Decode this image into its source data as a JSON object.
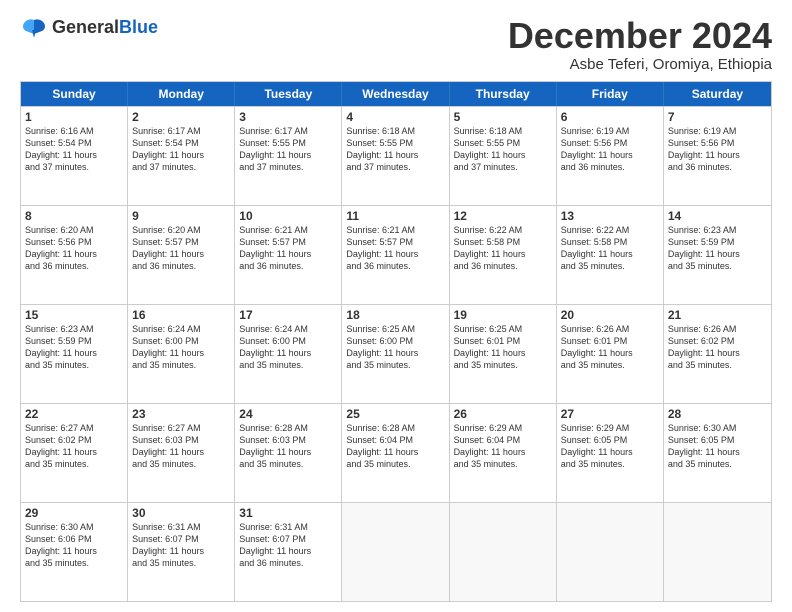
{
  "header": {
    "logo_general": "General",
    "logo_blue": "Blue",
    "month": "December 2024",
    "location": "Asbe Teferi, Oromiya, Ethiopia"
  },
  "days_of_week": [
    "Sunday",
    "Monday",
    "Tuesday",
    "Wednesday",
    "Thursday",
    "Friday",
    "Saturday"
  ],
  "weeks": [
    [
      {
        "day": "1",
        "lines": [
          "Sunrise: 6:16 AM",
          "Sunset: 5:54 PM",
          "Daylight: 11 hours",
          "and 37 minutes."
        ]
      },
      {
        "day": "2",
        "lines": [
          "Sunrise: 6:17 AM",
          "Sunset: 5:54 PM",
          "Daylight: 11 hours",
          "and 37 minutes."
        ]
      },
      {
        "day": "3",
        "lines": [
          "Sunrise: 6:17 AM",
          "Sunset: 5:55 PM",
          "Daylight: 11 hours",
          "and 37 minutes."
        ]
      },
      {
        "day": "4",
        "lines": [
          "Sunrise: 6:18 AM",
          "Sunset: 5:55 PM",
          "Daylight: 11 hours",
          "and 37 minutes."
        ]
      },
      {
        "day": "5",
        "lines": [
          "Sunrise: 6:18 AM",
          "Sunset: 5:55 PM",
          "Daylight: 11 hours",
          "and 37 minutes."
        ]
      },
      {
        "day": "6",
        "lines": [
          "Sunrise: 6:19 AM",
          "Sunset: 5:56 PM",
          "Daylight: 11 hours",
          "and 36 minutes."
        ]
      },
      {
        "day": "7",
        "lines": [
          "Sunrise: 6:19 AM",
          "Sunset: 5:56 PM",
          "Daylight: 11 hours",
          "and 36 minutes."
        ]
      }
    ],
    [
      {
        "day": "8",
        "lines": [
          "Sunrise: 6:20 AM",
          "Sunset: 5:56 PM",
          "Daylight: 11 hours",
          "and 36 minutes."
        ]
      },
      {
        "day": "9",
        "lines": [
          "Sunrise: 6:20 AM",
          "Sunset: 5:57 PM",
          "Daylight: 11 hours",
          "and 36 minutes."
        ]
      },
      {
        "day": "10",
        "lines": [
          "Sunrise: 6:21 AM",
          "Sunset: 5:57 PM",
          "Daylight: 11 hours",
          "and 36 minutes."
        ]
      },
      {
        "day": "11",
        "lines": [
          "Sunrise: 6:21 AM",
          "Sunset: 5:57 PM",
          "Daylight: 11 hours",
          "and 36 minutes."
        ]
      },
      {
        "day": "12",
        "lines": [
          "Sunrise: 6:22 AM",
          "Sunset: 5:58 PM",
          "Daylight: 11 hours",
          "and 36 minutes."
        ]
      },
      {
        "day": "13",
        "lines": [
          "Sunrise: 6:22 AM",
          "Sunset: 5:58 PM",
          "Daylight: 11 hours",
          "and 35 minutes."
        ]
      },
      {
        "day": "14",
        "lines": [
          "Sunrise: 6:23 AM",
          "Sunset: 5:59 PM",
          "Daylight: 11 hours",
          "and 35 minutes."
        ]
      }
    ],
    [
      {
        "day": "15",
        "lines": [
          "Sunrise: 6:23 AM",
          "Sunset: 5:59 PM",
          "Daylight: 11 hours",
          "and 35 minutes."
        ]
      },
      {
        "day": "16",
        "lines": [
          "Sunrise: 6:24 AM",
          "Sunset: 6:00 PM",
          "Daylight: 11 hours",
          "and 35 minutes."
        ]
      },
      {
        "day": "17",
        "lines": [
          "Sunrise: 6:24 AM",
          "Sunset: 6:00 PM",
          "Daylight: 11 hours",
          "and 35 minutes."
        ]
      },
      {
        "day": "18",
        "lines": [
          "Sunrise: 6:25 AM",
          "Sunset: 6:00 PM",
          "Daylight: 11 hours",
          "and 35 minutes."
        ]
      },
      {
        "day": "19",
        "lines": [
          "Sunrise: 6:25 AM",
          "Sunset: 6:01 PM",
          "Daylight: 11 hours",
          "and 35 minutes."
        ]
      },
      {
        "day": "20",
        "lines": [
          "Sunrise: 6:26 AM",
          "Sunset: 6:01 PM",
          "Daylight: 11 hours",
          "and 35 minutes."
        ]
      },
      {
        "day": "21",
        "lines": [
          "Sunrise: 6:26 AM",
          "Sunset: 6:02 PM",
          "Daylight: 11 hours",
          "and 35 minutes."
        ]
      }
    ],
    [
      {
        "day": "22",
        "lines": [
          "Sunrise: 6:27 AM",
          "Sunset: 6:02 PM",
          "Daylight: 11 hours",
          "and 35 minutes."
        ]
      },
      {
        "day": "23",
        "lines": [
          "Sunrise: 6:27 AM",
          "Sunset: 6:03 PM",
          "Daylight: 11 hours",
          "and 35 minutes."
        ]
      },
      {
        "day": "24",
        "lines": [
          "Sunrise: 6:28 AM",
          "Sunset: 6:03 PM",
          "Daylight: 11 hours",
          "and 35 minutes."
        ]
      },
      {
        "day": "25",
        "lines": [
          "Sunrise: 6:28 AM",
          "Sunset: 6:04 PM",
          "Daylight: 11 hours",
          "and 35 minutes."
        ]
      },
      {
        "day": "26",
        "lines": [
          "Sunrise: 6:29 AM",
          "Sunset: 6:04 PM",
          "Daylight: 11 hours",
          "and 35 minutes."
        ]
      },
      {
        "day": "27",
        "lines": [
          "Sunrise: 6:29 AM",
          "Sunset: 6:05 PM",
          "Daylight: 11 hours",
          "and 35 minutes."
        ]
      },
      {
        "day": "28",
        "lines": [
          "Sunrise: 6:30 AM",
          "Sunset: 6:05 PM",
          "Daylight: 11 hours",
          "and 35 minutes."
        ]
      }
    ],
    [
      {
        "day": "29",
        "lines": [
          "Sunrise: 6:30 AM",
          "Sunset: 6:06 PM",
          "Daylight: 11 hours",
          "and 35 minutes."
        ]
      },
      {
        "day": "30",
        "lines": [
          "Sunrise: 6:31 AM",
          "Sunset: 6:07 PM",
          "Daylight: 11 hours",
          "and 35 minutes."
        ]
      },
      {
        "day": "31",
        "lines": [
          "Sunrise: 6:31 AM",
          "Sunset: 6:07 PM",
          "Daylight: 11 hours",
          "and 36 minutes."
        ]
      },
      {
        "day": "",
        "lines": []
      },
      {
        "day": "",
        "lines": []
      },
      {
        "day": "",
        "lines": []
      },
      {
        "day": "",
        "lines": []
      }
    ]
  ]
}
